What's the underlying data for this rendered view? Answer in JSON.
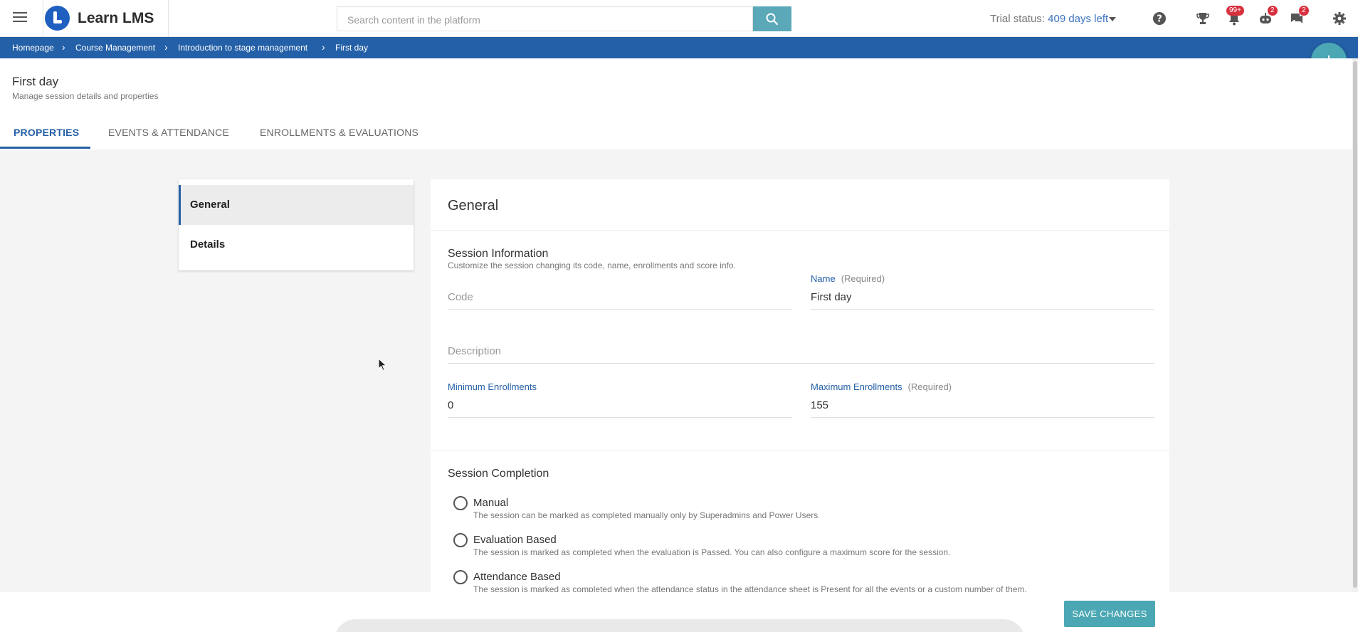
{
  "app": {
    "name": "Learn LMS"
  },
  "search": {
    "placeholder": "Search content in the platform"
  },
  "trial": {
    "prefix": "Trial status:",
    "days": "409 days left"
  },
  "notifications": {
    "bell_badge": "99+",
    "robot_badge": "2",
    "chat_badge": "2"
  },
  "breadcrumb": [
    "Homepage",
    "Course Management",
    "Introduction to stage management",
    "First day"
  ],
  "header": {
    "title": "First day",
    "subtitle": "Manage session details and properties"
  },
  "tabs": [
    "PROPERTIES",
    "EVENTS & ATTENDANCE",
    "ENROLLMENTS & EVALUATIONS"
  ],
  "sidenav": [
    "General",
    "Details"
  ],
  "general": {
    "title": "General",
    "session_info": {
      "title": "Session Information",
      "subtitle": "Customize the session changing its code, name, enrollments and score info.",
      "code_placeholder": "Code",
      "name_label": "Name",
      "name_required": "(Required)",
      "name_value": "First day",
      "description_placeholder": "Description",
      "min_label": "Minimum Enrollments",
      "min_value": "0",
      "max_label": "Maximum Enrollments",
      "max_required": "(Required)",
      "max_value": "155"
    },
    "completion": {
      "title": "Session Completion",
      "options": [
        {
          "label": "Manual",
          "desc": "The session can be marked as completed manually only by Superadmins and Power Users"
        },
        {
          "label": "Evaluation Based",
          "desc": "The session is marked as completed when the evaluation is Passed. You can also configure a maximum score for the session."
        },
        {
          "label": "Attendance Based",
          "desc": "The session is marked as completed when the attendance status in the attendance sheet is Present for all the events or a custom number of them."
        }
      ]
    }
  },
  "footer": {
    "save_label": "SAVE CHANGES"
  },
  "colors": {
    "primary": "#2460a7",
    "accent": "#4ba7b3",
    "badge": "#d9303e"
  }
}
